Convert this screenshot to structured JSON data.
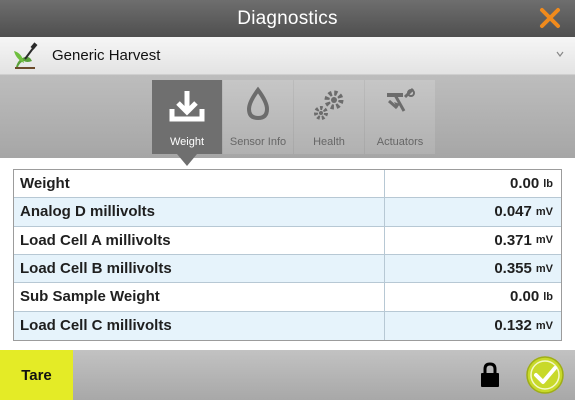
{
  "window": {
    "title": "Diagnostics"
  },
  "selector": {
    "value": "Generic Harvest"
  },
  "tabs": [
    {
      "label": "Weight",
      "icon": "download-icon",
      "active": true
    },
    {
      "label": "Sensor Info",
      "icon": "droplet-icon",
      "active": false
    },
    {
      "label": "Health",
      "icon": "gears-icon",
      "active": false
    },
    {
      "label": "Actuators",
      "icon": "actuator-icon",
      "active": false
    }
  ],
  "table": {
    "rows": [
      {
        "name": "Weight",
        "value": "0.00",
        "unit": "lb"
      },
      {
        "name": "Analog D millivolts",
        "value": "0.047",
        "unit": "mV"
      },
      {
        "name": "Load Cell A millivolts",
        "value": "0.371",
        "unit": "mV"
      },
      {
        "name": "Load Cell B millivolts",
        "value": "0.355",
        "unit": "mV"
      },
      {
        "name": "Sub Sample Weight",
        "value": "0.00",
        "unit": "lb"
      },
      {
        "name": "Load Cell C millivolts",
        "value": "0.132",
        "unit": "mV"
      }
    ]
  },
  "footer": {
    "tare_label": "Tare"
  },
  "colors": {
    "accent": "#e4eb26",
    "close": "#f08a1c",
    "ok": "#c8d92a"
  }
}
